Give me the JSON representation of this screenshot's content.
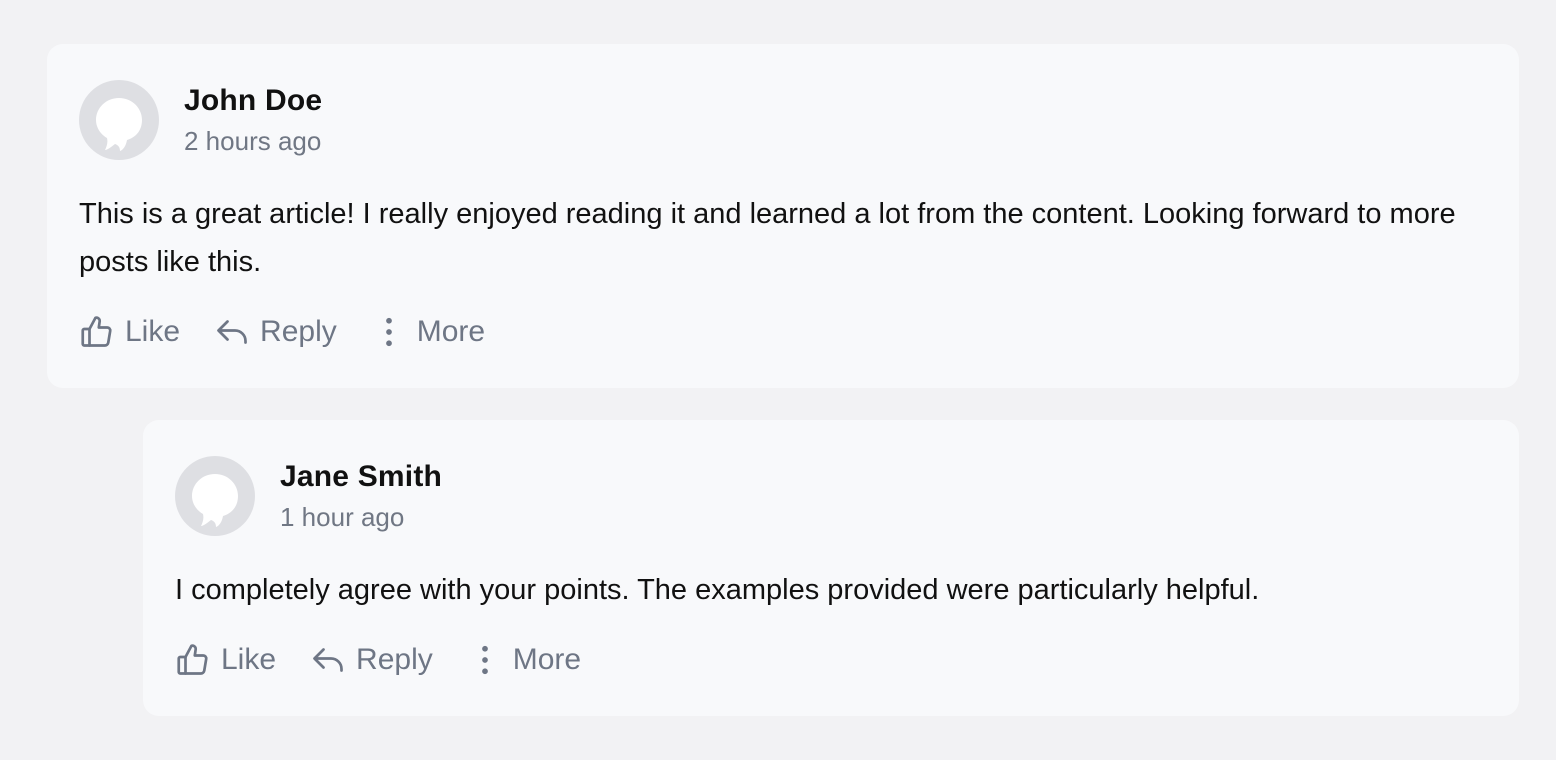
{
  "comments": [
    {
      "author": "John Doe",
      "time": "2 hours ago",
      "text": "This is a great article! I really enjoyed reading it and learned a lot from the content. Looking forward to more posts like this.",
      "actions": {
        "like": "Like",
        "reply": "Reply",
        "more": "More"
      }
    },
    {
      "author": "Jane Smith",
      "time": "1 hour ago",
      "text": "I completely agree with your points. The examples provided were particularly helpful.",
      "actions": {
        "like": "Like",
        "reply": "Reply",
        "more": "More"
      }
    }
  ],
  "icons": {
    "avatar": "avatar-placeholder-icon",
    "like": "thumbs-up-icon",
    "reply": "reply-arrow-icon",
    "more": "more-vertical-icon"
  },
  "colors": {
    "page_background": "#f2f2f4",
    "card_background": "#f8f9fb",
    "avatar_background": "#dedfe3",
    "muted_text": "#6e7685",
    "primary_text": "#111111"
  }
}
